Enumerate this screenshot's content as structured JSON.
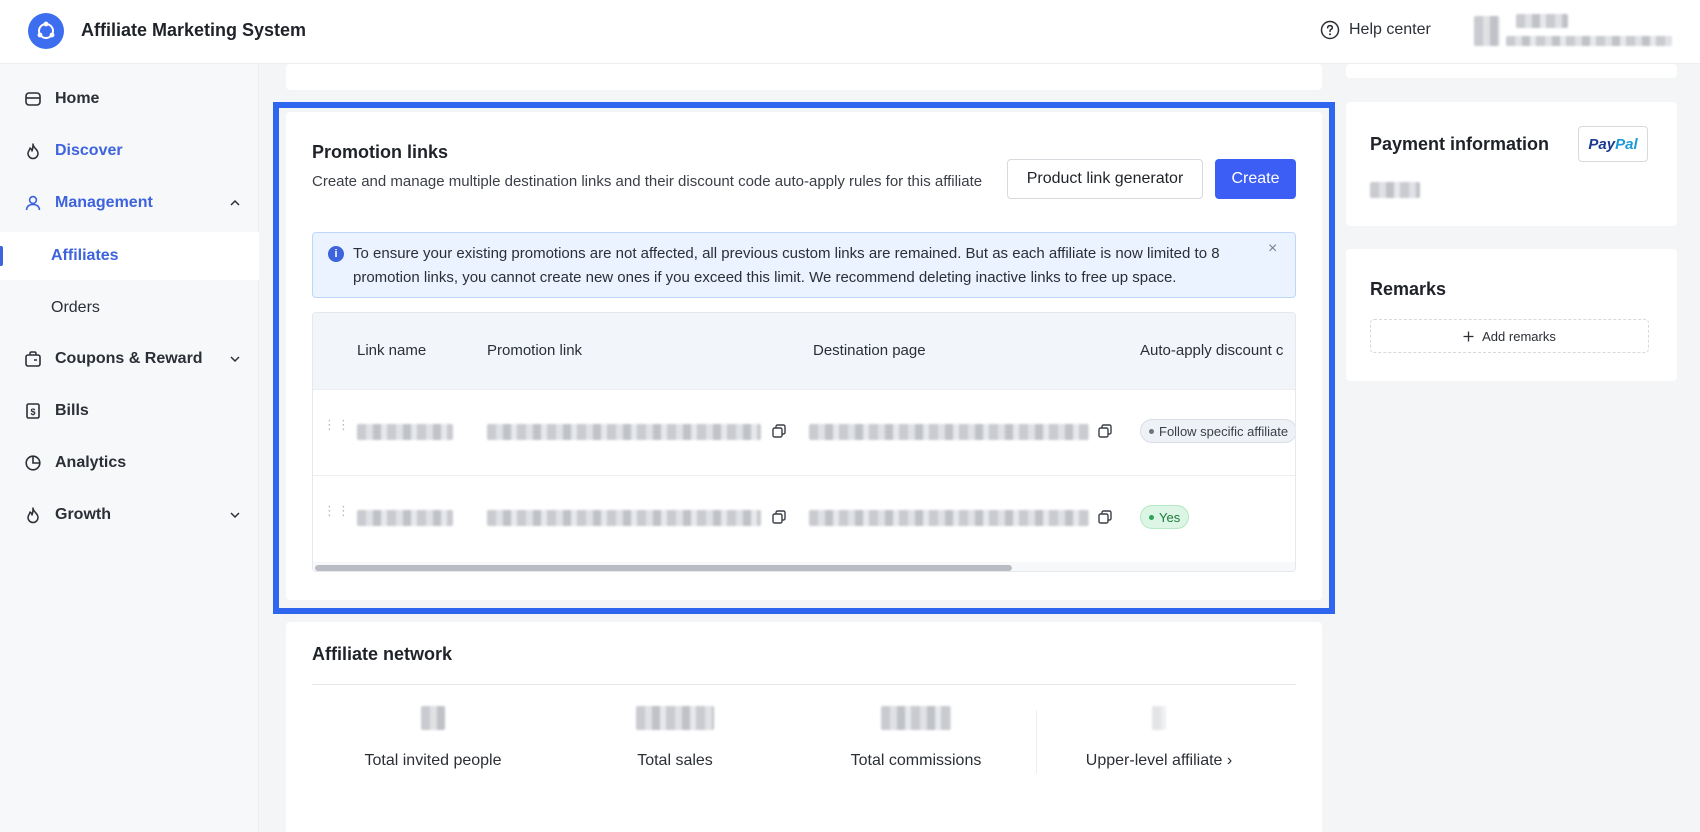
{
  "app": {
    "title": "Affiliate Marketing System"
  },
  "header": {
    "help_label": "Help center"
  },
  "sidebar": {
    "items": [
      {
        "label": "Home"
      },
      {
        "label": "Discover"
      },
      {
        "label": "Management"
      },
      {
        "label": "Affiliates"
      },
      {
        "label": "Orders"
      },
      {
        "label": "Coupons & Reward"
      },
      {
        "label": "Bills"
      },
      {
        "label": "Analytics"
      },
      {
        "label": "Growth"
      }
    ]
  },
  "promotion_links": {
    "title": "Promotion links",
    "description": "Create and manage multiple destination links and their discount code auto-apply rules for this affiliate",
    "product_link_generator_label": "Product link generator",
    "create_label": "Create",
    "notice": "To ensure your existing promotions are not affected, all previous custom links are remained. But as each affiliate is now limited to 8 promotion links, you cannot create new ones if you exceed this limit. We recommend deleting inactive links to free up space.",
    "close_symbol": "×",
    "columns": [
      "Link name",
      "Promotion link",
      "Destination page",
      "Auto-apply discount c"
    ],
    "rows": [
      {
        "auto_apply": "Follow specific affiliate"
      },
      {
        "auto_apply": "Yes"
      }
    ]
  },
  "payment": {
    "title": "Payment information",
    "paypal_pay": "Pay",
    "paypal_pal": "Pal"
  },
  "remarks": {
    "title": "Remarks",
    "add_label": "Add remarks"
  },
  "network": {
    "title": "Affiliate network",
    "stats": [
      {
        "label": "Total invited people"
      },
      {
        "label": "Total sales"
      },
      {
        "label": "Total commissions"
      },
      {
        "label": "Upper-level affiliate ›"
      }
    ]
  },
  "colors": {
    "accent": "#3d63dd",
    "primary_button": "#3d5ef5",
    "highlight_border": "#2f66f0"
  }
}
